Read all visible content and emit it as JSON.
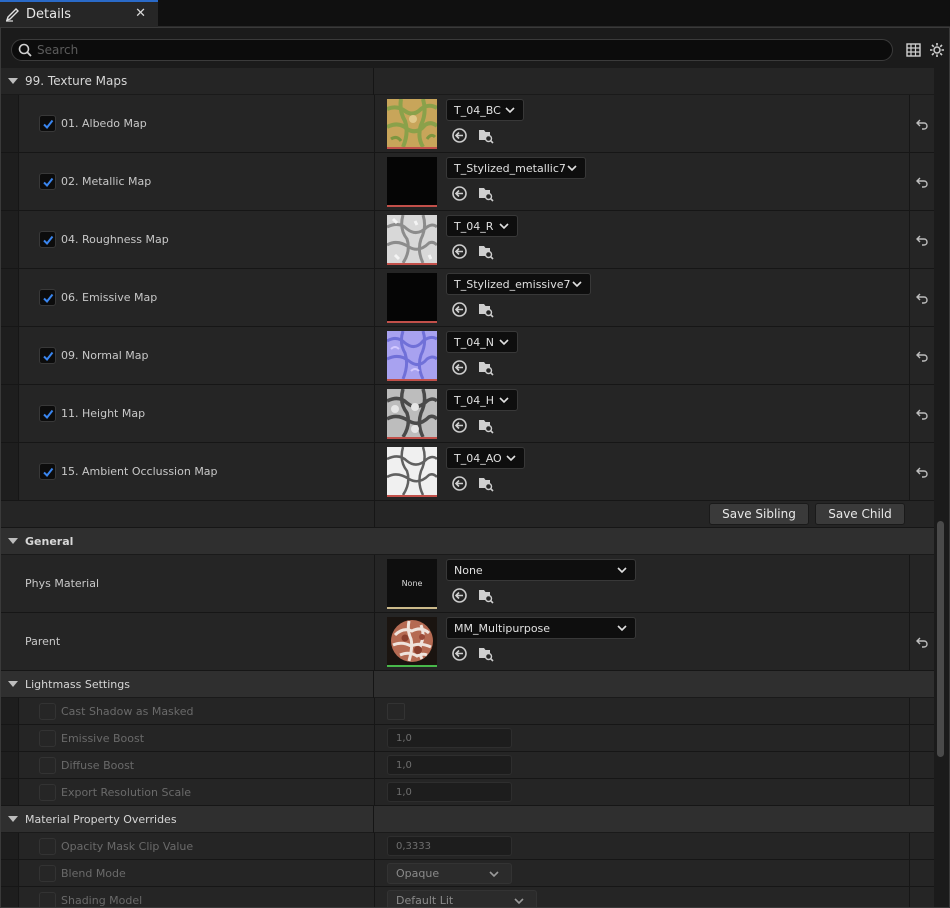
{
  "tab": {
    "title": "Details",
    "close": "✕"
  },
  "search": {
    "placeholder": "Search"
  },
  "texture_maps": {
    "title": "99. Texture Maps",
    "rows": [
      {
        "label": "01. Albedo Map",
        "texture": "T_04_BC",
        "thumb": "albedo"
      },
      {
        "label": "02. Metallic Map",
        "texture": "T_Stylized_metallic7",
        "thumb": "black"
      },
      {
        "label": "04. Roughness Map",
        "texture": "T_04_R",
        "thumb": "rough"
      },
      {
        "label": "06. Emissive Map",
        "texture": "T_Stylized_emissive7",
        "thumb": "black"
      },
      {
        "label": "09. Normal Map",
        "texture": "T_04_N",
        "thumb": "normal"
      },
      {
        "label": "11. Height Map",
        "texture": "T_04_H",
        "thumb": "height"
      },
      {
        "label": "15. Ambient Occlussion Map",
        "texture": "T_04_AO",
        "thumb": "ao"
      }
    ],
    "save_sibling": "Save Sibling",
    "save_child": "Save Child"
  },
  "general": {
    "title": "General",
    "phys_material": {
      "label": "Phys Material",
      "thumb_text": "None",
      "value": "None"
    },
    "parent": {
      "label": "Parent",
      "value": "MM_Multipurpose"
    }
  },
  "lightmass": {
    "title": "Lightmass Settings",
    "cast_shadow": "Cast Shadow as Masked",
    "emissive_boost": {
      "label": "Emissive Boost",
      "value": "1,0"
    },
    "diffuse_boost": {
      "label": "Diffuse Boost",
      "value": "1,0"
    },
    "export_res": {
      "label": "Export Resolution Scale",
      "value": "1,0"
    }
  },
  "overrides": {
    "title": "Material Property Overrides",
    "opacity_clip": {
      "label": "Opacity Mask Clip Value",
      "value": "0,3333"
    },
    "blend_mode": {
      "label": "Blend Mode",
      "value": "Opaque"
    },
    "shading_model": {
      "label": "Shading Model",
      "value": "Default Lit"
    }
  },
  "colors": {
    "accent": "#2a6ac8",
    "check": "#2a7ae2",
    "texture_underline": "#c2504a",
    "material_underline": "#48b84a"
  }
}
